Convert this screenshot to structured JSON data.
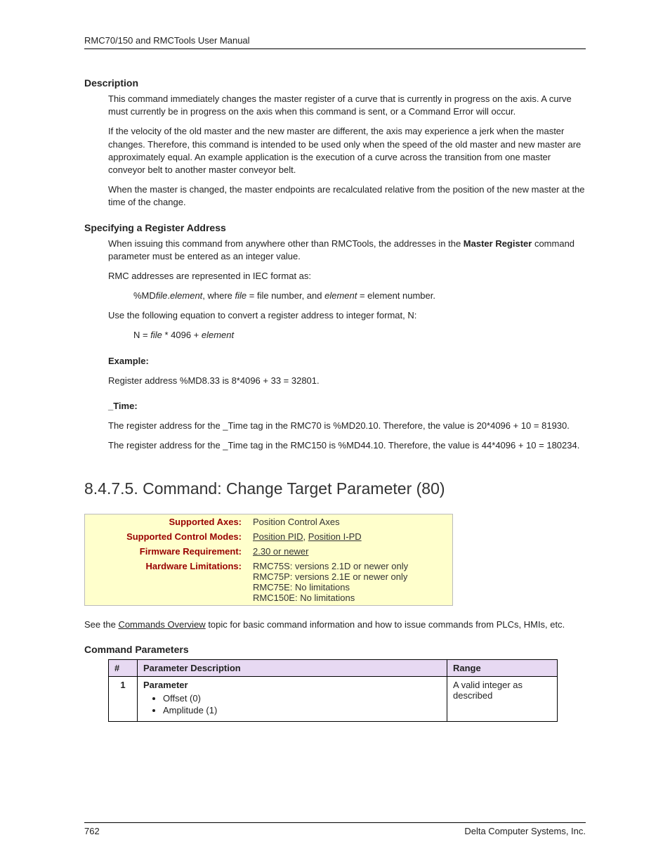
{
  "header": {
    "left": "RMC70/150 and RMCTools User Manual"
  },
  "sections": {
    "desc_hdr": "Description",
    "desc_p1": "This command immediately changes the master register of a curve that is currently in progress on the axis. A curve must currently be in progress on the axis when this command is sent, or a Command Error will occur.",
    "desc_p2": "If the velocity of the old master and the new master are different, the axis may experience a jerk when the master changes. Therefore, this command is intended to be used only when the speed of the old master and new master are approximately equal. An example application is the execution of a curve across the transition from one master conveyor belt to another master conveyor belt.",
    "desc_p3": "When the master is changed, the master endpoints are recalculated relative from the position of the new master at the time of the change.",
    "reg_hdr": "Specifying a Register Address",
    "reg_p1_pre": "When issuing this command from anywhere other than RMCTools, the addresses in the ",
    "reg_p1_bold": "Master Register",
    "reg_p1_post": " command parameter must be entered as an integer value.",
    "reg_p2": "RMC addresses are represented in IEC format as:",
    "reg_fmt_pre": "%MD",
    "reg_fmt_file": "file",
    "reg_fmt_dot": ".",
    "reg_fmt_elem": "element",
    "reg_fmt_where": ", where ",
    "reg_fmt_file2": "file",
    "reg_fmt_eqfile": " = file number, and ",
    "reg_fmt_elem2": "element",
    "reg_fmt_eqelem": " = element number.",
    "reg_p3": "Use the following equation to convert a register address to integer format, N:",
    "reg_eqn_pre": "N =  ",
    "reg_eqn_file": "file",
    "reg_eqn_mid": " * 4096 + ",
    "reg_eqn_elem": "element",
    "example_hdr": "Example:",
    "example_p": "Register address %MD8.33 is 8*4096 + 33 = 32801.",
    "time_hdr": "_Time:",
    "time_p1": "The register address for the _Time tag in the RMC70 is %MD20.10. Therefore, the value is 20*4096 + 10 = 81930.",
    "time_p2": "The register address for the _Time tag in the RMC150 is %MD44.10. Therefore, the value is 44*4096 + 10 = 180234."
  },
  "big_heading": "8.4.7.5. Command: Change Target Parameter (80)",
  "info": {
    "rows": [
      {
        "label": "Supported Axes:",
        "value": "Position Control Axes",
        "link": false
      },
      {
        "label": "Supported Control Modes:",
        "value_links": [
          "Position PID",
          "Position I-PD"
        ],
        "sep": ", "
      },
      {
        "label": "Firmware Requirement:",
        "value": "2.30 or newer",
        "link": true
      },
      {
        "label": "Hardware Limitations:",
        "lines": [
          "RMC75S: versions 2.1D or newer only",
          "RMC75P: versions 2.1E or newer only",
          "RMC75E: No limitations",
          "RMC150E: No limitations"
        ]
      }
    ]
  },
  "after_info_pre": "See the ",
  "after_info_link": "Commands Overview",
  "after_info_post": " topic for basic command information and how to issue commands from PLCs, HMIs, etc.",
  "params_hdr": "Command Parameters",
  "params_table": {
    "head": {
      "num": "#",
      "desc": "Parameter Description",
      "range": "Range"
    },
    "row": {
      "num": "1",
      "label": "Parameter",
      "items": [
        "Offset (0)",
        "Amplitude (1)"
      ],
      "range": "A valid integer as described"
    }
  },
  "footer": {
    "left": "762",
    "right": "Delta Computer Systems, Inc."
  }
}
